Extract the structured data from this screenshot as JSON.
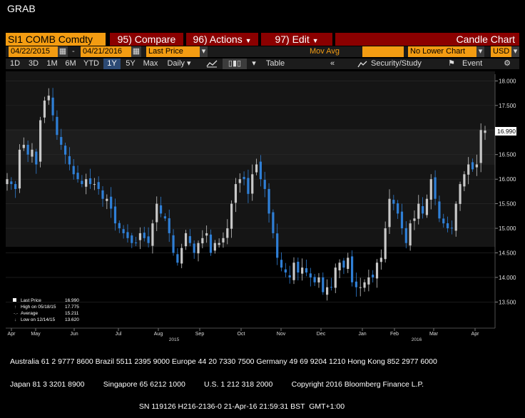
{
  "screen_title": "GRAB",
  "toolbar": {
    "ticker": "SI1 COMB Comdty",
    "compare": "95) Compare",
    "actions": "96) Actions",
    "edit": "97) Edit",
    "chart_type": "Candle Chart"
  },
  "controls": {
    "start_date": "04/22/2015",
    "end_date": "04/21/2016",
    "field": "Last Price",
    "study": "Mov Avg",
    "lower_chart": "No Lower Chart",
    "currency": "USD"
  },
  "ranges": [
    "1D",
    "3D",
    "1M",
    "6M",
    "YTD",
    "1Y",
    "5Y",
    "Max"
  ],
  "selected_range": "1Y",
  "periodicity": "Daily",
  "table_label": "Table",
  "security_study": "Security/Study",
  "event_label": "Event",
  "legend": {
    "last_price_label": "Last Price",
    "last_price": "16.990",
    "high_label": "High on 05/18/15",
    "high": "17.775",
    "average_label": "Average",
    "average": "15.211",
    "low_label": "Low on 12/14/15",
    "low": "13.620"
  },
  "last_price_tag": "16.990",
  "colors": {
    "up": "#c8c8c8",
    "down": "#2f7fd6",
    "accent": "#f39c12",
    "header": "#8b0000"
  },
  "chart_data": {
    "type": "candlestick",
    "y_ticks": [
      "18.000",
      "17.500",
      "17.000",
      "16.500",
      "16.000",
      "15.500",
      "15.000",
      "14.500",
      "14.000",
      "13.500"
    ],
    "ylim": [
      13.2,
      18.05
    ],
    "month_labels": [
      "Apr",
      "May",
      "Jun",
      "Jul",
      "Aug",
      "Sep",
      "Oct",
      "Nov",
      "Dec",
      "Jan",
      "Feb",
      "Mar",
      "Apr"
    ],
    "year_labels": [
      "2015",
      "2016"
    ],
    "closes": [
      16.0,
      15.9,
      15.8,
      16.6,
      16.7,
      16.5,
      16.6,
      16.3,
      17.2,
      17.6,
      17.7,
      17.3,
      16.9,
      16.7,
      16.5,
      16.3,
      16.1,
      16.0,
      15.9,
      16.0,
      15.9,
      15.9,
      15.8,
      15.6,
      15.6,
      15.4,
      15.1,
      15.0,
      14.9,
      14.8,
      14.7,
      14.7,
      14.9,
      14.8,
      14.7,
      15.1,
      15.5,
      15.3,
      15.2,
      14.9,
      14.5,
      14.3,
      14.6,
      14.9,
      14.7,
      14.5,
      14.7,
      14.8,
      14.9,
      14.5,
      14.7,
      14.7,
      14.8,
      15.0,
      15.5,
      15.9,
      16.0,
      16.0,
      15.7,
      16.1,
      16.3,
      16.0,
      15.8,
      15.3,
      14.9,
      14.4,
      14.2,
      14.1,
      14.0,
      14.3,
      14.1,
      14.2,
      14.1,
      14.0,
      13.9,
      14.0,
      13.7,
      13.8,
      13.8,
      14.2,
      14.3,
      14.2,
      14.4,
      13.9,
      13.8,
      13.8,
      13.9,
      14.0,
      14.0,
      14.3,
      14.4,
      15.0,
      15.6,
      15.5,
      15.3,
      15.0,
      14.7,
      15.1,
      15.2,
      15.5,
      15.3,
      15.6,
      16.0,
      15.6,
      15.2,
      15.1,
      15.0,
      15.0,
      15.5,
      15.9,
      16.1,
      16.3,
      16.2,
      16.3,
      17.0,
      16.99
    ]
  },
  "footer_lines": [
    "Australia 61 2 9777 8600 Brazil 5511 2395 9000 Europe 44 20 7330 7500 Germany 49 69 9204 1210 Hong Kong 852 2977 6000",
    "Japan 81 3 3201 8900         Singapore 65 6212 1000         U.S. 1 212 318 2000         Copyright 2016 Bloomberg Finance L.P.",
    "                                                              SN 119126 H216-2136-0 21-Apr-16 21:59:31 BST  GMT+1:00"
  ]
}
